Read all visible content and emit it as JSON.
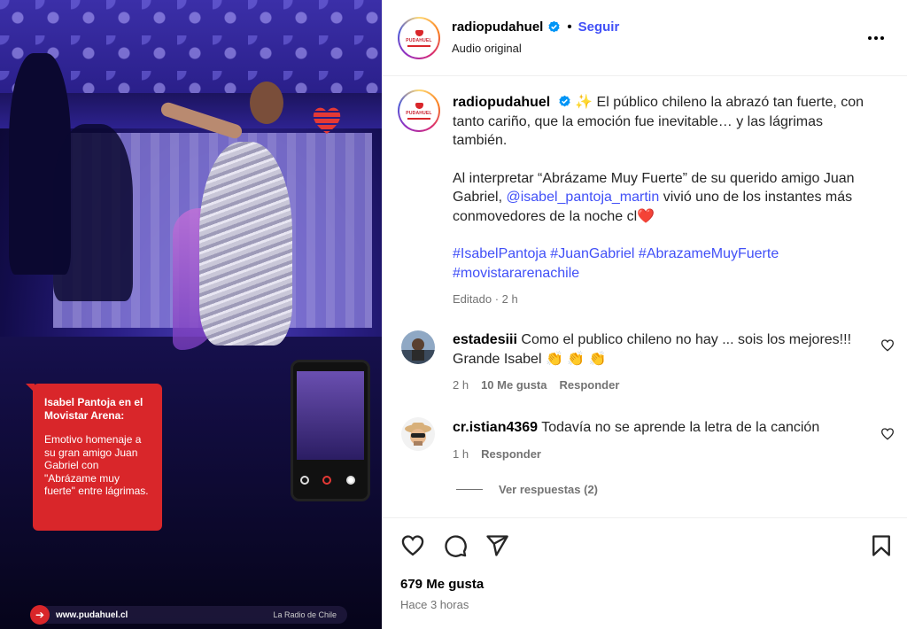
{
  "media": {
    "card_title": "Isabel Pantoja en el Movistar Arena:",
    "card_body": "Emotivo homenaje a su gran amigo Juan Gabriel con \"Abrázame muy fuerte\" entre lágrimas.",
    "footer_url": "www.pudahuel.cl",
    "footer_tagline": "La Radio de Chile",
    "brand_color": "#d9262a"
  },
  "header": {
    "username": "radiopudahuel",
    "separator": "•",
    "follow_label": "Seguir",
    "subtitle": "Audio original",
    "more_icon": "more-horizontal-icon",
    "logo_text": "PUDAHUEL"
  },
  "caption": {
    "username": "radiopudahuel",
    "emoji": "✨",
    "paragraph1": "El público chileno la abrazó tan fuerte, con tanto cariño, que la emoción fue inevitable… y las lágrimas también.",
    "paragraph2_a": "Al interpretar “Abrázame Muy Fuerte” de su querido amigo Juan Gabriel, ",
    "mention": "@isabel_pantoja_martin",
    "paragraph2_b": " vivió uno de los instantes más conmovedores de la noche ",
    "paragraph2_flag": "cl",
    "paragraph2_heart": "❤️",
    "hashtags": "#IsabelPantoja #JuanGabriel #AbrazameMuyFuerte #movistararenachile",
    "edited": "Editado · 2 h"
  },
  "comments": [
    {
      "username": "estadesiii",
      "text": "Como el publico chileno no hay ... sois los mejores!!! Grande Isabel 👏 👏 👏",
      "time": "2 h",
      "likes": "10 Me gusta",
      "reply_label": "Responder"
    },
    {
      "username": "cr.istian4369",
      "text": "Todavía no se aprende la letra de la canción",
      "time": "1 h",
      "reply_label": "Responder"
    }
  ],
  "view_replies": "Ver respuestas (2)",
  "footer": {
    "likes": "679 Me gusta",
    "time_ago": "Hace 3 horas"
  },
  "colors": {
    "link": "#4150f7",
    "muted": "#737373",
    "verified": "#0095f6"
  }
}
